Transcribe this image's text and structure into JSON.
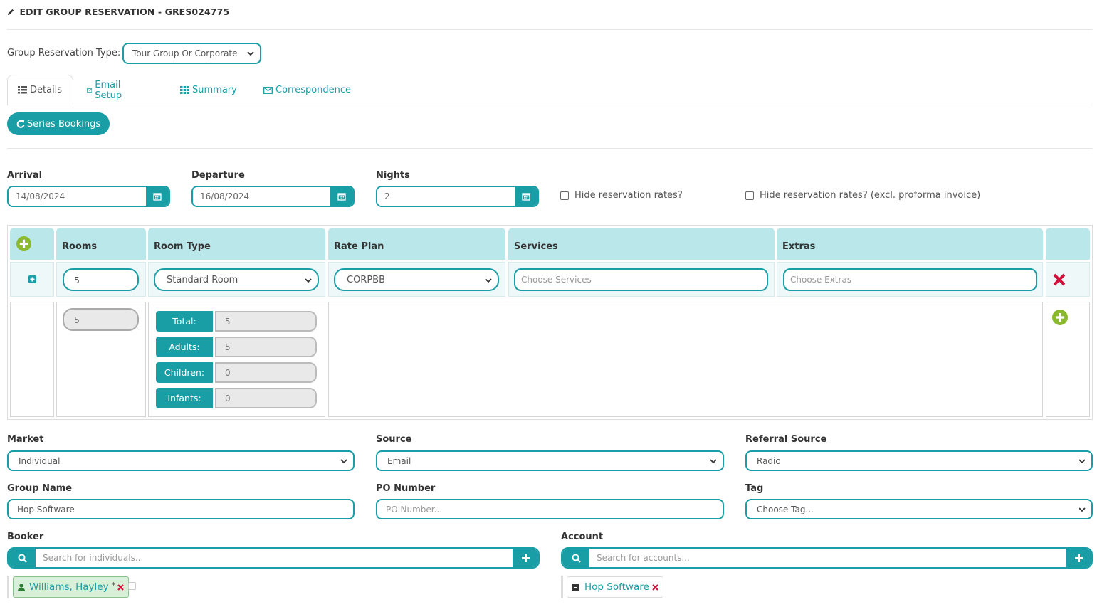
{
  "header": {
    "title": "EDIT GROUP RESERVATION - GRES024775"
  },
  "group_type": {
    "label": "Group Reservation Type:",
    "value": "Tour Group Or Corporate"
  },
  "tabs": [
    {
      "label": "Details",
      "icon": "list-icon"
    },
    {
      "label": "Email Setup",
      "icon": "envelope-icon"
    },
    {
      "label": "Summary",
      "icon": "grid-icon"
    },
    {
      "label": "Correspondence",
      "icon": "envelope-icon"
    }
  ],
  "series_button": {
    "label": "Series Bookings"
  },
  "dates": {
    "arrival_label": "Arrival",
    "arrival": "14/08/2024",
    "departure_label": "Departure",
    "departure": "16/08/2024",
    "nights_label": "Nights",
    "nights": "2"
  },
  "options": {
    "hide_rates": "Hide reservation rates?",
    "hide_rates_excl": "Hide reservation rates? (excl. proforma invoice)"
  },
  "room_table": {
    "headers": {
      "rooms": "Rooms",
      "room_type": "Room Type",
      "rate_plan": "Rate Plan",
      "services": "Services",
      "extras": "Extras"
    },
    "row": {
      "rooms": "5",
      "room_type": "Standard Room",
      "rate_plan": "CORPBB",
      "services_placeholder": "Choose Services",
      "extras_placeholder": "Choose Extras"
    },
    "detail": {
      "rooms": "5",
      "occupancy": [
        {
          "label": "Total:",
          "value": "5"
        },
        {
          "label": "Adults:",
          "value": "5"
        },
        {
          "label": "Children:",
          "value": "0"
        },
        {
          "label": "Infants:",
          "value": "0"
        }
      ]
    }
  },
  "fields": {
    "market_label": "Market",
    "market": "Individual",
    "source_label": "Source",
    "source": "Email",
    "referral_label": "Referral Source",
    "referral": "Radio",
    "group_name_label": "Group Name",
    "group_name": "Hop Software",
    "po_label": "PO Number",
    "po_placeholder": "PO Number...",
    "tag_label": "Tag",
    "tag": "Choose Tag..."
  },
  "booker": {
    "label": "Booker",
    "placeholder": "Search for individuals...",
    "chip": "Williams, Hayley"
  },
  "account": {
    "label": "Account",
    "placeholder": "Search for accounts...",
    "chip": "Hop Software"
  },
  "colors": {
    "accent": "#1a9ea6",
    "header_bg": "#b9e7ea",
    "add_green": "#8ab92d",
    "remove_red": "#d0103a"
  }
}
